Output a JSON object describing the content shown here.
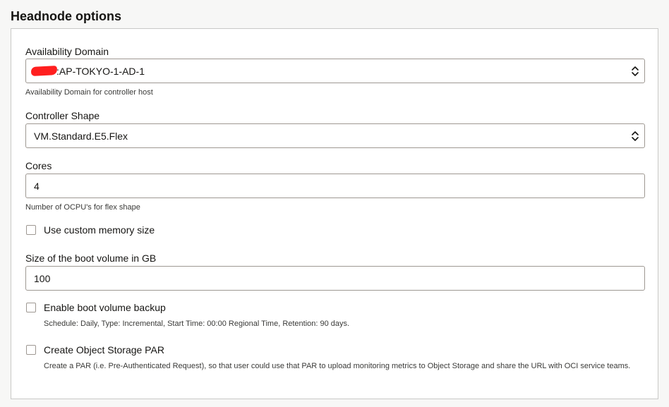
{
  "section": {
    "title": "Headnode options"
  },
  "fields": {
    "availability_domain": {
      "label": "Availability Domain",
      "value": ":AP-TOKYO-1-AD-1",
      "help": "Availability Domain for controller host"
    },
    "controller_shape": {
      "label": "Controller Shape",
      "value": "VM.Standard.E5.Flex"
    },
    "cores": {
      "label": "Cores",
      "value": "4",
      "help": "Number of OCPU's for flex shape"
    },
    "custom_memory": {
      "label": "Use custom memory size",
      "checked": false
    },
    "boot_volume_size": {
      "label": "Size of the boot volume in GB",
      "value": "100"
    },
    "boot_volume_backup": {
      "label": "Enable boot volume backup",
      "checked": false,
      "help": "Schedule: Daily, Type: Incremental, Start Time: 00:00 Regional Time, Retention: 90 days."
    },
    "object_storage_par": {
      "label": "Create Object Storage PAR",
      "checked": false,
      "help": "Create a PAR (i.e. Pre-Authenticated Request), so that user could use that PAR to upload monitoring metrics to Object Storage and share the URL with OCI service teams."
    }
  },
  "icons": {
    "select_arrow": "chevron-up-down-icon",
    "redaction": "red-redaction-mark"
  },
  "colors": {
    "border": "#9e9892",
    "panel_border": "#c9c9c7",
    "background": "#f7f7f6",
    "redaction": "#ff1f1f"
  }
}
